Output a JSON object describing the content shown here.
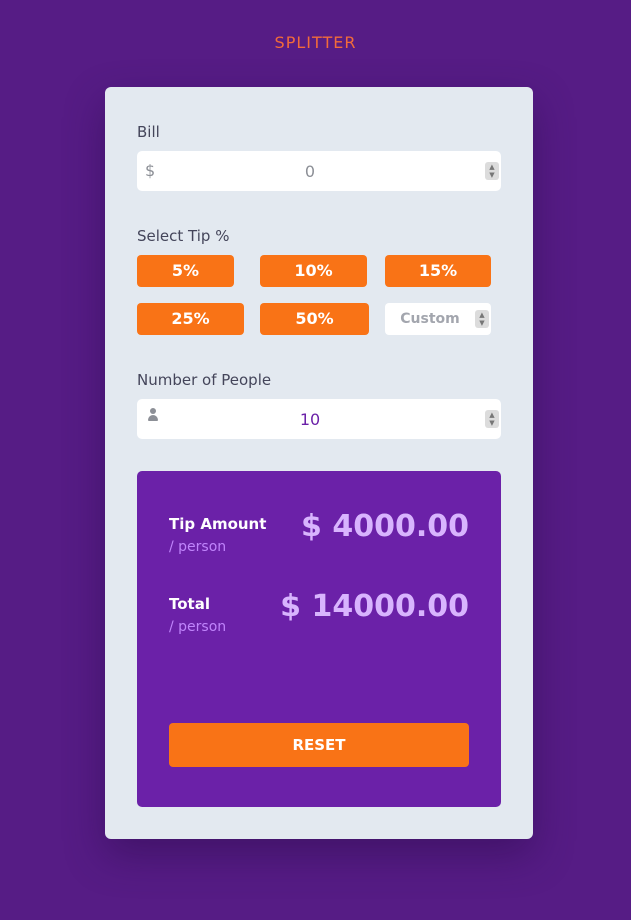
{
  "app": {
    "title": "SPLITTER"
  },
  "bill": {
    "label": "Bill",
    "currency_symbol": "$",
    "value": "0"
  },
  "tip": {
    "label": "Select Tip %",
    "options": [
      "5%",
      "10%",
      "15%",
      "25%",
      "50%"
    ],
    "custom_placeholder": "Custom"
  },
  "people": {
    "label": "Number of People",
    "value": "10"
  },
  "results": {
    "tip_label": "Tip Amount",
    "tip_sub": "/ person",
    "tip_value": "$ 4000.00",
    "total_label": "Total",
    "total_sub": "/ person",
    "total_value": "$ 14000.00",
    "reset_label": "RESET"
  },
  "colors": {
    "background": "#561c85",
    "card": "#e3e9f0",
    "accent": "#f97316",
    "results_panel": "#6b21a8",
    "amount_text": "#d8b4fe",
    "title_text": "#f26b3a"
  },
  "icons": {
    "bill_prefix": "dollar-icon",
    "people_prefix": "person-icon",
    "spinner": "spinner-icon"
  }
}
